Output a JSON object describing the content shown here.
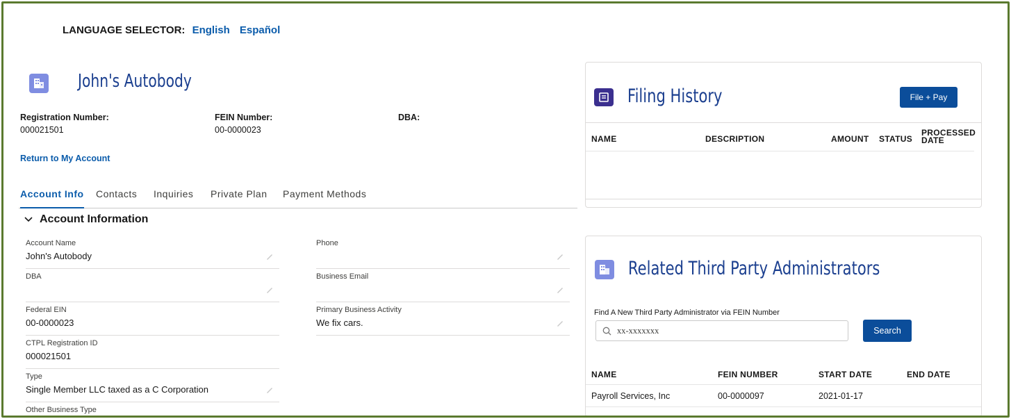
{
  "language": {
    "label": "LANGUAGE SELECTOR:",
    "options": [
      "English",
      "Español"
    ]
  },
  "account": {
    "name": "John's Autobody",
    "registration_number_label": "Registration Number:",
    "registration_number": "000021501",
    "fein_number_label": "FEIN Number:",
    "fein_number": "00-0000023",
    "dba_label": "DBA:",
    "return_link": "Return to My Account"
  },
  "tabs": [
    {
      "label": "Account Info",
      "active": true
    },
    {
      "label": "Contacts",
      "active": false
    },
    {
      "label": "Inquiries",
      "active": false
    },
    {
      "label": "Private Plan",
      "active": false
    },
    {
      "label": "Payment Methods",
      "active": false
    }
  ],
  "account_information": {
    "section_title": "Account Information",
    "left_fields": [
      {
        "label": "Account Name",
        "value": "John's Autobody",
        "editable": true
      },
      {
        "label": "DBA",
        "value": "",
        "editable": true
      },
      {
        "label": "Federal EIN",
        "value": "00-0000023",
        "editable": false
      },
      {
        "label": "CTPL Registration ID",
        "value": "000021501",
        "editable": false
      },
      {
        "label": "Type",
        "value": "Single Member LLC taxed as a C Corporation",
        "editable": true
      },
      {
        "label": "Other Business Type",
        "value": "",
        "editable": true
      }
    ],
    "right_fields": [
      {
        "label": "Phone",
        "value": "",
        "editable": true
      },
      {
        "label": "Business Email",
        "value": "",
        "editable": true
      },
      {
        "label": "Primary Business Activity",
        "value": "We fix cars.",
        "editable": true
      }
    ]
  },
  "filing_history": {
    "title": "Filing History",
    "button": "File + Pay",
    "columns": [
      "NAME",
      "DESCRIPTION",
      "AMOUNT",
      "STATUS",
      "PROCESSED",
      "DATE"
    ],
    "rows": []
  },
  "third_party": {
    "title": "Related Third Party Administrators",
    "search_label": "Find A New Third Party Administrator via FEIN Number",
    "search_placeholder": "xx-xxxxxxx",
    "search_button": "Search",
    "columns": [
      "NAME",
      "FEIN NUMBER",
      "START DATE",
      "END DATE"
    ],
    "rows": [
      {
        "name": "Payroll Services, Inc",
        "fein": "00-0000097",
        "start": "2021-01-17",
        "end": ""
      }
    ]
  },
  "colors": {
    "brand_blue": "#1b3f8f",
    "link_blue": "#0b5cab",
    "button_blue": "#0b4d9a",
    "icon_purple": "#7f8de1",
    "filing_icon": "#3b2f8f",
    "frame_green": "#5a7a2e"
  }
}
